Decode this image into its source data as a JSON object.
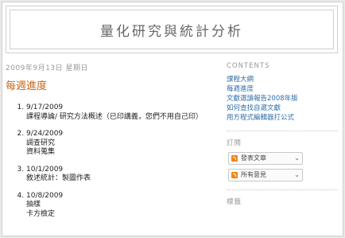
{
  "blog": {
    "title": "量化研究與統計分析"
  },
  "post": {
    "date": "2009年9月13日 星期日",
    "title": "每週進度",
    "weeks": [
      {
        "date": "9/17/2009",
        "topics": [
          "課程導論/ 研究方法概述（已印講義，您們不用自己印）"
        ]
      },
      {
        "date": "9/24/2009",
        "topics": [
          "調查研究",
          "資料蒐集"
        ]
      },
      {
        "date": "10/1/2009",
        "topics": [
          "敘述統計：製圖作表"
        ]
      },
      {
        "date": "10/8/2009",
        "topics": [
          "抽樣",
          "卡方檢定"
        ]
      }
    ]
  },
  "sidebar": {
    "contents_heading": "CONTENTS",
    "contents": [
      "課程大綱",
      "每週進度",
      "文獻選讀報告2008年版",
      "如何查找自選文獻",
      "用方程式編輯器打公式"
    ],
    "subscribe_heading": "訂閱",
    "feeds": [
      {
        "label": "發表文章",
        "icon": "rss-feed-icon"
      },
      {
        "label": "所有意見",
        "icon": "rss-feed-icon"
      }
    ],
    "tags_heading": "標籤"
  },
  "colors": {
    "post_title": "#c86614",
    "link": "#2f6ea8",
    "feed_icon": "#f0861b"
  }
}
